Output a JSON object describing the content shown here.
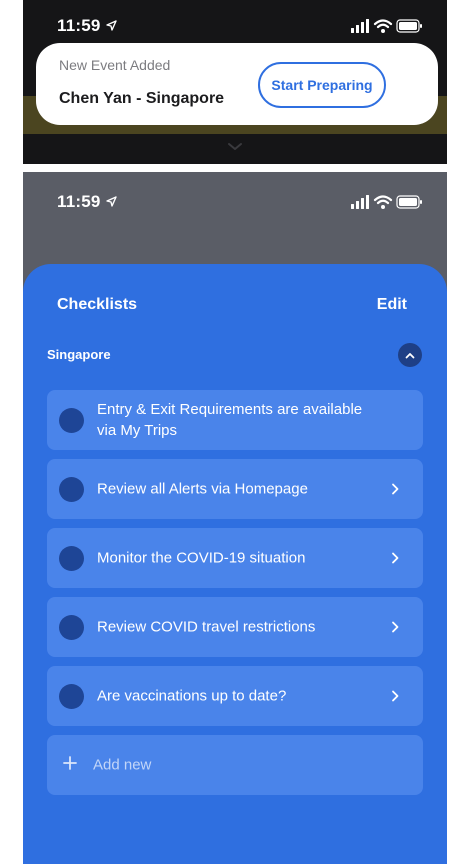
{
  "notification_screen": {
    "status": {
      "time": "11:59"
    },
    "notification": {
      "subtitle": "New Event Added",
      "title": "Chen Yan - Singapore",
      "action_label": "Start Preparing"
    }
  },
  "checklist_screen": {
    "status": {
      "time": "11:59"
    },
    "header": {
      "title": "Checklists",
      "edit_label": "Edit"
    },
    "section": {
      "label": "Singapore"
    },
    "items": [
      {
        "label": "Entry & Exit Requirements are available via My Trips",
        "has_chevron": false
      },
      {
        "label": "Review all Alerts via Homepage",
        "has_chevron": true
      },
      {
        "label": "Monitor the COVID-19 situation",
        "has_chevron": true
      },
      {
        "label": "Review COVID travel restrictions",
        "has_chevron": true
      },
      {
        "label": "Are vaccinations up to date?",
        "has_chevron": true
      }
    ],
    "add_new_label": "Add new"
  },
  "icons": {
    "location": "location-arrow-icon",
    "signal": "cellular-signal-icon",
    "wifi": "wifi-icon",
    "battery": "battery-icon",
    "collapse": "chevron-up-icon",
    "item_chevron": "chevron-right-icon",
    "add": "plus-icon",
    "grabber": "chevron-down-icon"
  },
  "colors": {
    "accent": "#2f6fe0",
    "sheet_background": "#2f6fe0",
    "item_background": "#4a84ea",
    "item_circle": "#1e4596"
  }
}
